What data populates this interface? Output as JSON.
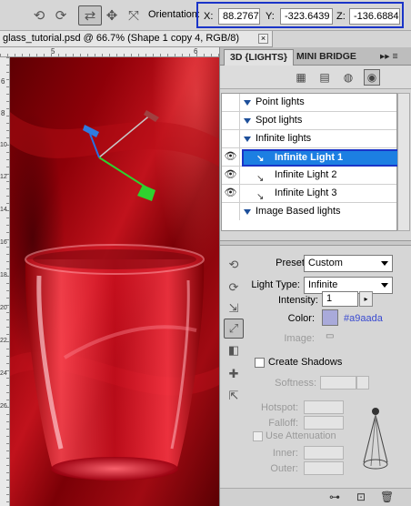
{
  "options_bar": {
    "tools": [
      "rotate-3d-icon",
      "roll-3d-icon",
      "drag-3d-icon",
      "slide-3d-icon",
      "scale-3d-icon"
    ],
    "orientation_label": "Orientation:",
    "x_label": "X:",
    "x_value": "88.2767",
    "y_label": "Y:",
    "y_value": "-323.6439",
    "z_label": "Z:",
    "z_value": "-136.6884",
    "highlight_color": "#1a34c8"
  },
  "document": {
    "tab_title": "glass_tutorial.psd @ 66.7% (Shape 1 copy 4, RGB/8)",
    "close_glyph": "×"
  },
  "rulers": {
    "top_numbers": [
      "5",
      "6"
    ],
    "left_numbers": [
      "6",
      "8",
      "10",
      "12",
      "14",
      "16",
      "18",
      "20",
      "22",
      "24",
      "26"
    ]
  },
  "panel": {
    "tab_3d": "3D {LIGHTS}",
    "tab_mini": "MINI BRIDGE",
    "menu_glyph": "▸▸ ≡",
    "filter_icons": [
      "scene-icon",
      "mesh-icon",
      "materials-icon",
      "lights-icon"
    ],
    "lights": [
      {
        "label": "Point lights",
        "type": "group",
        "visible": false
      },
      {
        "label": "Spot lights",
        "type": "group",
        "visible": false
      },
      {
        "label": "Infinite lights",
        "type": "group",
        "visible": false
      },
      {
        "label": "Infinite Light 1",
        "type": "item",
        "visible": true,
        "selected": true
      },
      {
        "label": "Infinite Light 2",
        "type": "item",
        "visible": true,
        "selected": false
      },
      {
        "label": "Infinite Light 3",
        "type": "item",
        "visible": true,
        "selected": false
      },
      {
        "label": "Image Based lights",
        "type": "group",
        "visible": false
      }
    ],
    "selection_color": "#1c7fe2",
    "preset_label": "Preset:",
    "preset_value": "Custom",
    "light_type_label": "Light Type:",
    "light_type_value": "Infinite",
    "intensity_label": "Intensity:",
    "intensity_value": "1",
    "color_label": "Color:",
    "color_hex": "#a9aada",
    "color_swatch": "#a9aada",
    "image_label": "Image:",
    "create_shadows_label": "Create Shadows",
    "create_shadows_checked": false,
    "softness_label": "Softness:",
    "hotspot_label": "Hotspot:",
    "falloff_label": "Falloff:",
    "use_attenuation_label": "Use Attenuation",
    "inner_label": "Inner:",
    "outer_label": "Outer:"
  }
}
